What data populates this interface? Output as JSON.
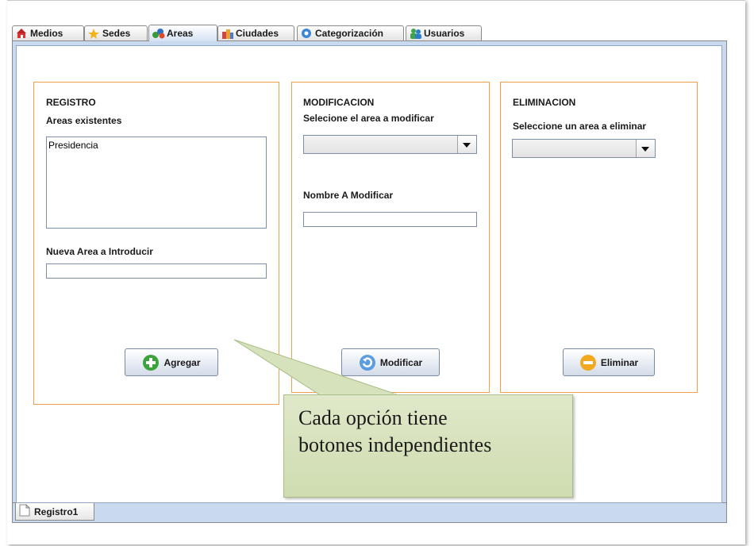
{
  "tabs": [
    {
      "label": "Medios",
      "icon": "house-icon"
    },
    {
      "label": "Sedes",
      "icon": "star-arrow-icon"
    },
    {
      "label": "Areas",
      "icon": "shapes-icon"
    },
    {
      "label": "Ciudades",
      "icon": "buildings-icon"
    },
    {
      "label": "Categorización",
      "icon": "gear-refresh-icon"
    },
    {
      "label": "Usuarios",
      "icon": "users-icon"
    }
  ],
  "active_tab": "Areas",
  "registro": {
    "title": "REGISTRO",
    "existing_label": "Areas existentes",
    "existing_items": [
      "Presidencia"
    ],
    "new_label": "Nueva Area a Introducir",
    "new_value": "",
    "button": "Agregar"
  },
  "modificacion": {
    "title": "MODIFICACION",
    "select_label": "Selecione el area a modificar",
    "select_value": "",
    "name_label": "Nombre A Modificar",
    "name_value": "",
    "button": "Modificar"
  },
  "eliminacion": {
    "title": "ELIMINACION",
    "select_label": "Seleccione un area a eliminar",
    "select_value": "",
    "button": "Eliminar"
  },
  "bottom_tab": "Registro1",
  "callout": {
    "line1": "Cada opción tiene",
    "line2": "botones independientes"
  },
  "colors": {
    "section_border": "#f0a04b",
    "panel_bg": "#c9daee",
    "callout_bg": "#dfe8c9"
  }
}
